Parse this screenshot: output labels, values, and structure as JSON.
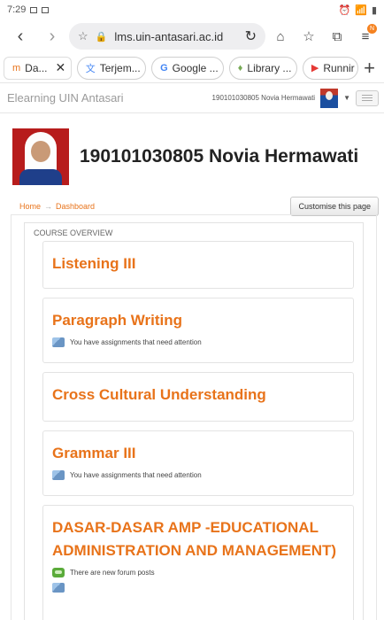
{
  "status": {
    "time": "7:29"
  },
  "browser": {
    "url": "lms.uin-antasari.ac.id",
    "tabs": [
      {
        "label": "Da...",
        "icon": "moodle-icon"
      },
      {
        "label": "Terjem...",
        "icon": "translate-icon"
      },
      {
        "label": "Google ...",
        "icon": "google-icon"
      },
      {
        "label": "Library ...",
        "icon": "library-icon"
      },
      {
        "label": "Runnir",
        "icon": "youtube-icon"
      }
    ],
    "tab_badge": "N",
    "accent": "#f58220"
  },
  "site": {
    "brand": "Elearning UIN Antasari",
    "user": "190101030805 Novia Hermawati"
  },
  "profile": {
    "name": "190101030805 Novia Hermawati"
  },
  "breadcrumb": {
    "home": "Home",
    "sep": "→",
    "current": "Dashboard"
  },
  "customise_label": "Customise this page",
  "overview": {
    "title": "COURSE OVERVIEW",
    "courses": [
      {
        "title": "Listening III"
      },
      {
        "title": "Paragraph Writing",
        "notice": "You have assignments that need attention"
      },
      {
        "title": "Cross Cultural Understanding"
      },
      {
        "title": "Grammar III",
        "notice": "You have assignments that need attention"
      },
      {
        "title": "DASAR-DASAR AMP -EDUCATIONAL ADMINISTRATION AND MANAGEMENT)",
        "notice": "There are new forum posts"
      }
    ]
  },
  "colors": {
    "link": "#e8731a",
    "text": "#222222"
  }
}
